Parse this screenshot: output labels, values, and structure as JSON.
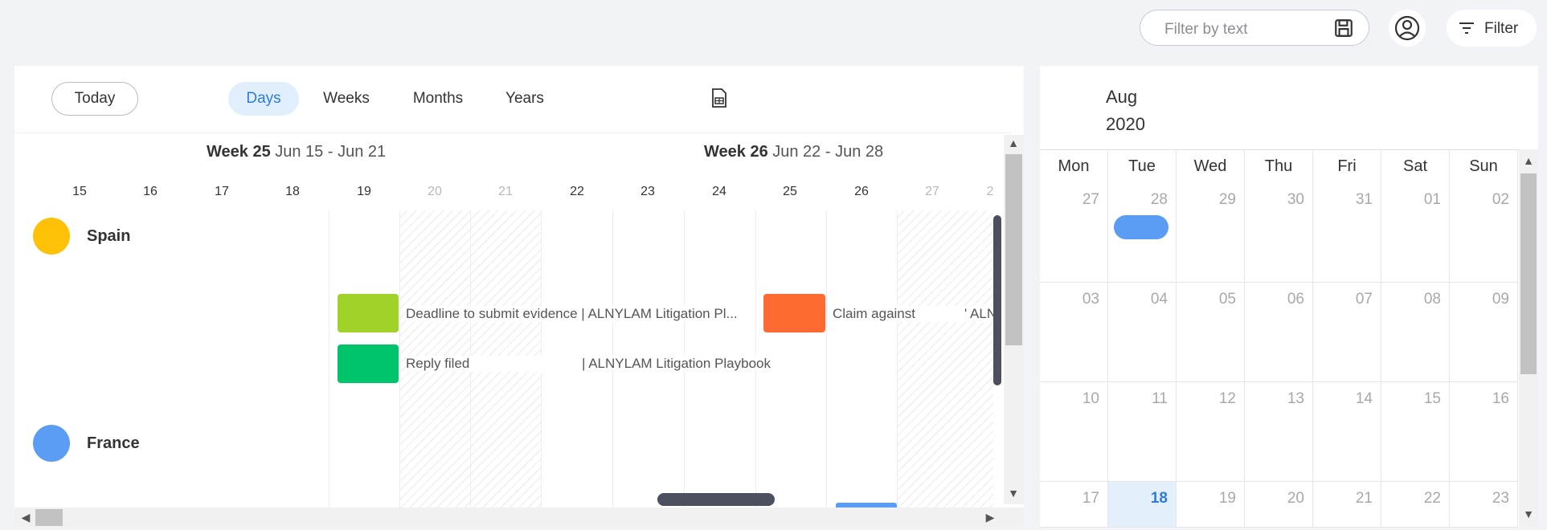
{
  "toolbar": {
    "filter_placeholder": "Filter by text",
    "filter_label": "Filter"
  },
  "timeline": {
    "today_label": "Today",
    "tabs": [
      {
        "label": "Days",
        "active": true
      },
      {
        "label": "Weeks",
        "active": false
      },
      {
        "label": "Months",
        "active": false
      },
      {
        "label": "Years",
        "active": false
      }
    ],
    "weeks": [
      {
        "week": "Week 25",
        "range": "Jun 15 - Jun 21"
      },
      {
        "week": "Week 26",
        "range": "Jun 22 - Jun 28"
      }
    ],
    "days": [
      "15",
      "16",
      "17",
      "18",
      "19",
      "20",
      "21",
      "22",
      "23",
      "24",
      "25",
      "26",
      "27",
      "2"
    ],
    "weekend_days": [
      "20",
      "21",
      "27",
      "2"
    ],
    "countries": [
      {
        "name": "Spain",
        "color": "#ffc107"
      },
      {
        "name": "France",
        "color": "#5b9cf5"
      }
    ],
    "events": [
      {
        "label": "Deadline to submit evidence | ALNYLAM Litigation Pl...",
        "color": "#a0d22a"
      },
      {
        "label": "Claim against",
        "color": "#ff6a32"
      },
      {
        "label": "' ALN",
        "color": ""
      },
      {
        "label": "Reply filed",
        "color": "#00c46c"
      },
      {
        "label": "| ALNYLAM Litigation Playbook",
        "color": ""
      }
    ]
  },
  "calendar": {
    "month": "Aug",
    "year": "2020",
    "weekdays": [
      "Mon",
      "Tue",
      "Wed",
      "Thu",
      "Fri",
      "Sat",
      "Sun"
    ],
    "weeks": [
      [
        "27",
        "28",
        "29",
        "30",
        "31",
        "01",
        "02"
      ],
      [
        "03",
        "04",
        "05",
        "06",
        "07",
        "08",
        "09"
      ],
      [
        "10",
        "11",
        "12",
        "13",
        "14",
        "15",
        "16"
      ],
      [
        "17",
        "18",
        "19",
        "20",
        "21",
        "22",
        "23"
      ]
    ],
    "today": "18",
    "event_color": "#5b9cf5"
  },
  "colors": {
    "accent": "#2d7be0",
    "active_tab_bg": "#e1effc",
    "background": "#f1f3f6"
  }
}
